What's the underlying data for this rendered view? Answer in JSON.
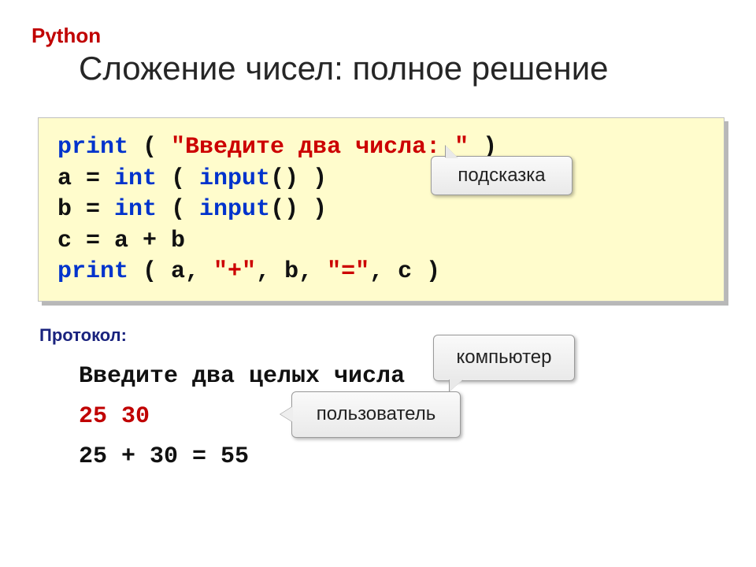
{
  "lang": "Python",
  "title": "Сложение чисел: полное решение",
  "code": {
    "l1_kw": "print",
    "l1_open": " ( ",
    "l1_str": "\"Введите два числа: \"",
    "l1_close": " )",
    "l2_a_eq": "a = ",
    "l2_int": "int",
    "l2_mid": " ( ",
    "l2_input": "input",
    "l2_tail": "() )",
    "l3_b_eq": "b = ",
    "l3_int": "int",
    "l3_mid": " ( ",
    "l3_input": "input",
    "l3_tail": "() )",
    "l4": "c = a + b",
    "l5_kw": "print",
    "l5_open": " ( a, ",
    "l5_s1": "\"+\"",
    "l5_m1": ", b, ",
    "l5_s2": "\"=\"",
    "l5_close": ", c )"
  },
  "callouts": {
    "hint": "подсказка",
    "computer": "компьютер",
    "user": "пользователь"
  },
  "protocol": {
    "label": "Протокол:",
    "line1": "Введите два целых числа",
    "line2": "25 30",
    "line3": "25 + 30 = 55"
  }
}
